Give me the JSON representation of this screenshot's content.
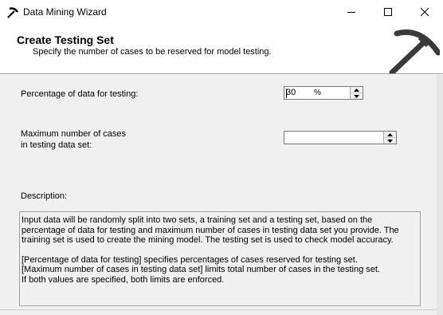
{
  "window": {
    "title": "Data Mining Wizard",
    "icon": "pickaxe-icon",
    "controls": [
      "minimize-icon",
      "maximize-icon",
      "close-icon"
    ]
  },
  "header": {
    "title": "Create Testing Set",
    "subtitle": "Specify the number of cases to be reserved for model testing.",
    "graphic": "pickaxe-icon"
  },
  "form": {
    "percentage": {
      "label": "Percentage of data for testing:",
      "value": "30",
      "unit": "%"
    },
    "max_cases": {
      "label_line1": "Maximum number of cases",
      "label_line2": "in testing data set:",
      "value": ""
    }
  },
  "description": {
    "label": "Description:",
    "paragraph1": "Input data will be randomly split into two sets, a training set and a testing set, based on the percentage of data for testing and maximum number of cases in testing data set you provide. The training set is used to create the mining model. The testing set is used to check model accuracy.",
    "line2": "[Percentage of data for testing] specifies percentages of cases reserved for testing set.",
    "line3": "[Maximum number of cases in testing data set] limits total number of cases in the testing set.",
    "line4": "If both values are specified, both limits are enforced."
  },
  "colors": {
    "background": "#f0f0f0",
    "header_background": "#ffffff",
    "border": "#a0a0a0"
  }
}
